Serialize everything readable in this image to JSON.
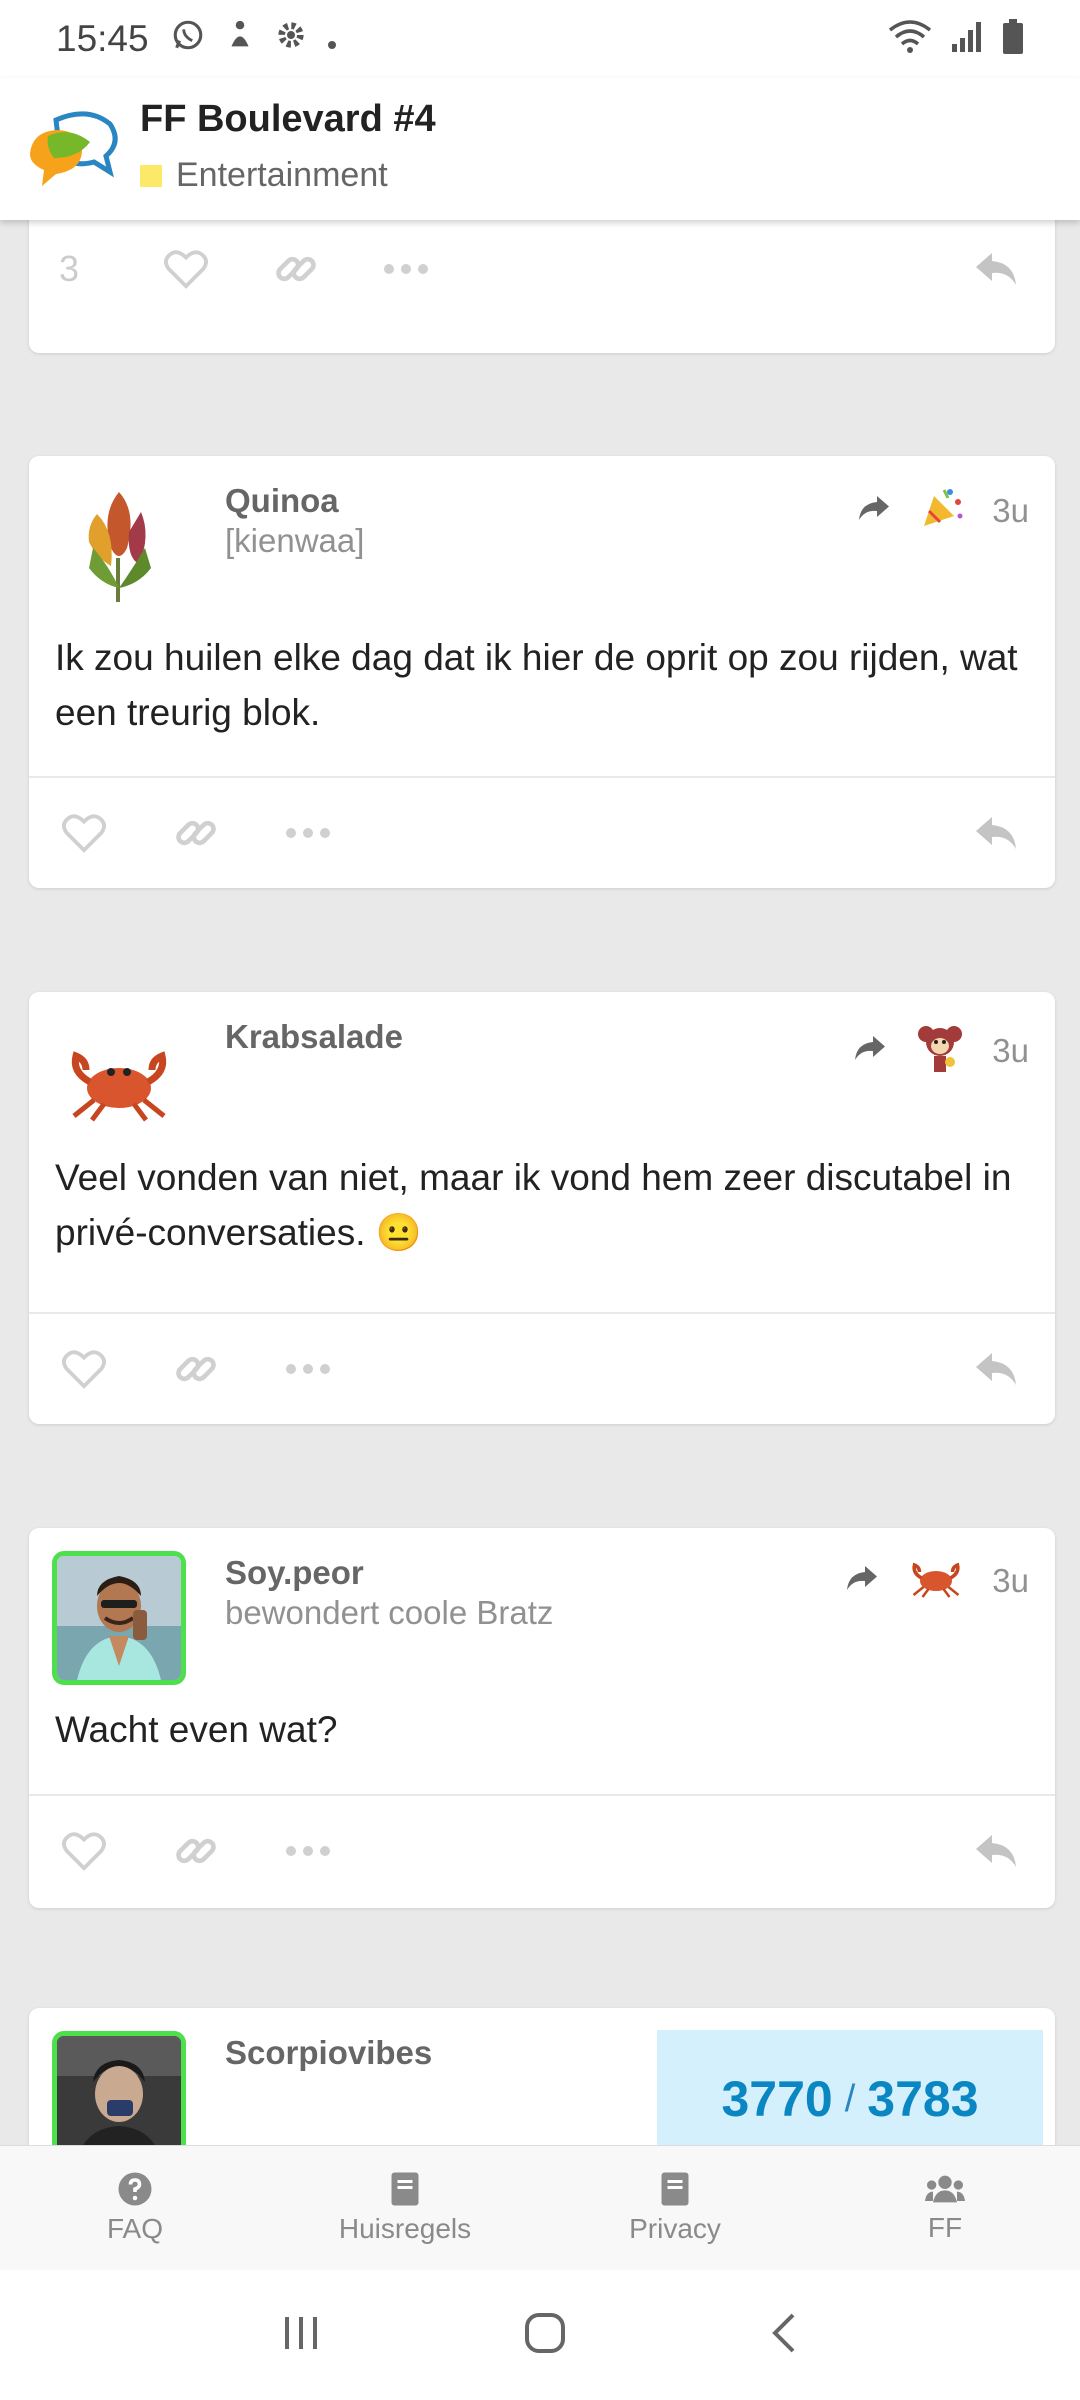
{
  "status_bar": {
    "time": "15:45"
  },
  "header": {
    "title": "FF Boulevard #4",
    "category": "Entertainment",
    "category_color": "#fde968"
  },
  "top_card": {
    "like_count": "3"
  },
  "posts": [
    {
      "author": "Quinoa",
      "subtitle": "[kienwaa]",
      "time": "3u",
      "text": "Ik zou huilen elke dag dat ik hier de oprit op zou rijden, wat een treurig blok."
    },
    {
      "author": "Krabsalade",
      "subtitle": "",
      "time": "3u",
      "text": "Veel vonden van niet, maar ik vond hem zeer discutabel in privé-conversaties. 😐"
    },
    {
      "author": "Soy.peor",
      "subtitle": "bewondert coole Bratz",
      "time": "3u",
      "text": "Wacht even wat?"
    },
    {
      "author": "Scorpiovibes"
    }
  ],
  "progress": {
    "current": "3770",
    "separator": "/",
    "total": "3783"
  },
  "bottom_nav": [
    {
      "label": "FAQ"
    },
    {
      "label": "Huisregels"
    },
    {
      "label": "Privacy"
    },
    {
      "label": "FF"
    }
  ],
  "colors": {
    "avatar_border": "#4ee04c",
    "progress_bg": "#d4f0fc",
    "progress_text": "#0a86c3"
  }
}
